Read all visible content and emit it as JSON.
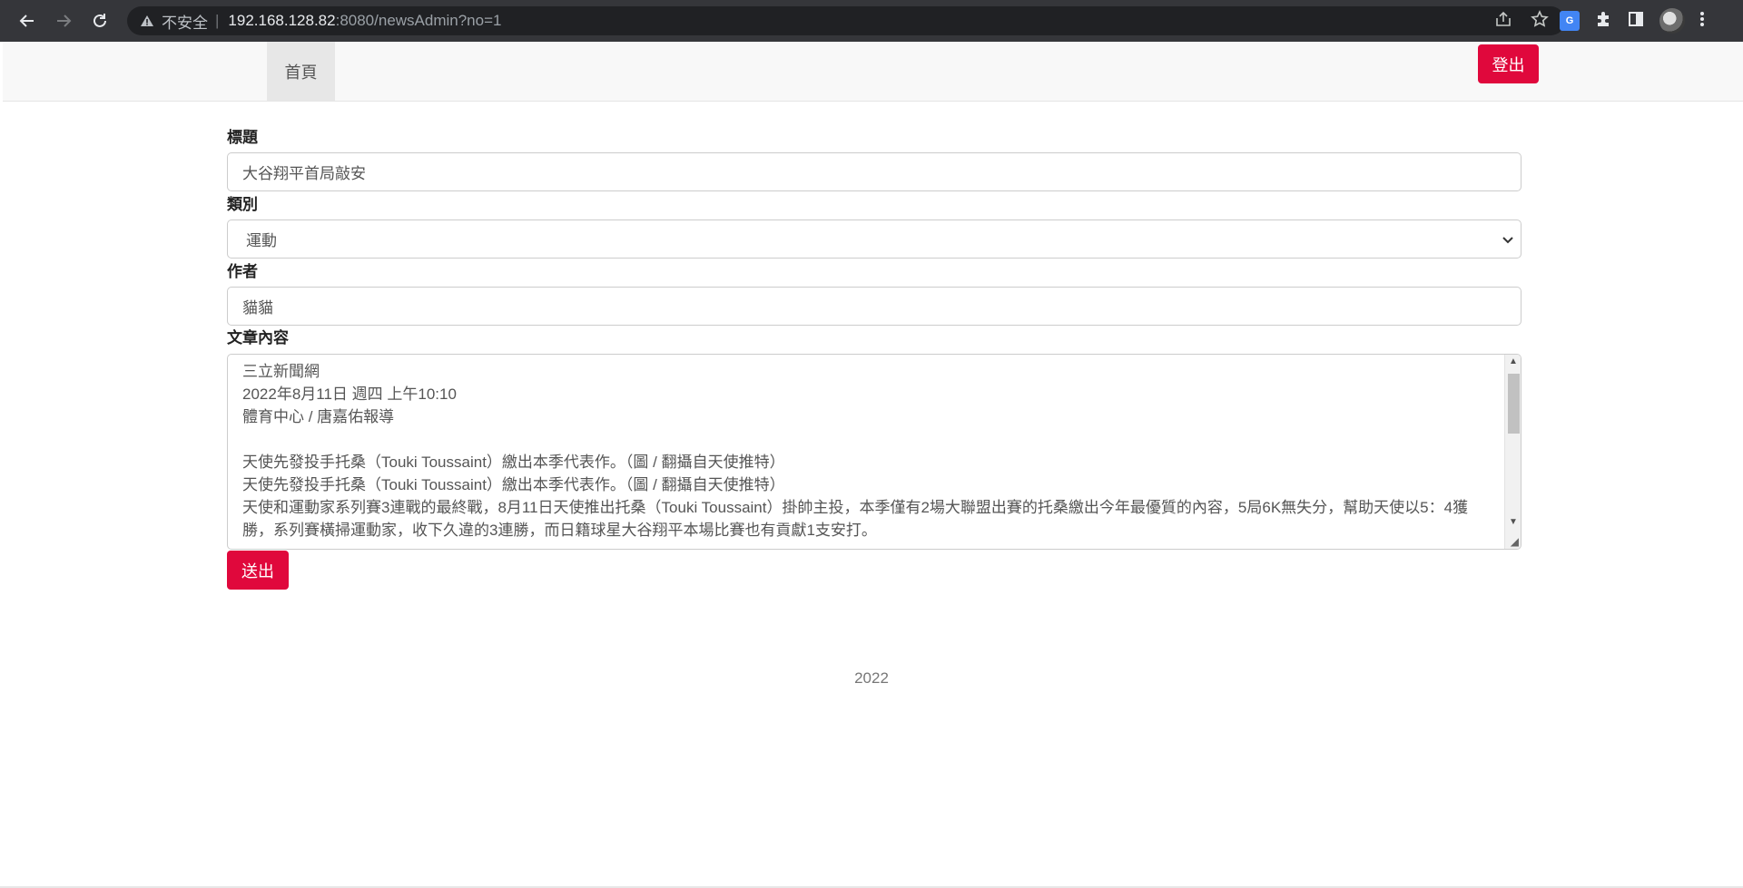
{
  "browser": {
    "security_label": "不安全",
    "url_host": "192.168.128.82",
    "url_rest": ":8080/newsAdmin?no=1",
    "translate_label": "G"
  },
  "nav": {
    "home_label": "首頁",
    "logout_label": "登出"
  },
  "form": {
    "title_label": "標題",
    "title_value": "大谷翔平首局敲安",
    "category_label": "類別",
    "category_value": "運動",
    "author_label": "作者",
    "author_value": "貓貓",
    "content_label": "文章內容",
    "content_value": "三立新聞網\n2022年8月11日 週四 上午10:10\n體育中心 / 唐嘉佑報導\n\n天使先發投手托桑（Touki Toussaint）繳出本季代表作。（圖 / 翻攝自天使推特）\n天使先發投手托桑（Touki Toussaint）繳出本季代表作。（圖 / 翻攝自天使推特）\n天使和運動家系列賽3連戰的最終戰，8月11日天使推出托桑（Touki Toussaint）掛帥主投，本季僅有2場大聯盟出賽的托桑繳出今年最優質的內容，5局6K無失分，幫助天使以5：4獲勝，系列賽橫掃運動家，收下久違的3連勝，而日籍球星大谷翔平本場比賽也有貢獻1支安打。",
    "submit_label": "送出"
  },
  "footer": {
    "year": "2022"
  },
  "colors": {
    "accent": "#e0083c",
    "chrome": "#35363a"
  }
}
